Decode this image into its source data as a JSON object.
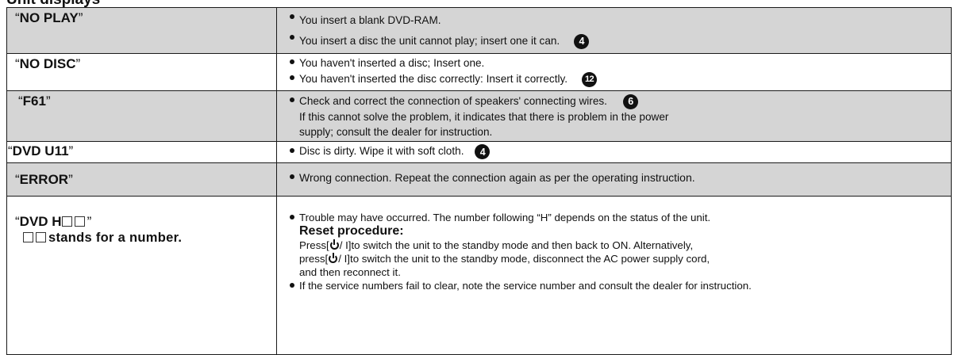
{
  "heading": "Unit displays",
  "rows": [
    {
      "code_open": "“",
      "code": "NO PLAY",
      "code_close": "”",
      "lines": [
        {
          "text": "You insert a blank DVD-RAM."
        },
        {
          "text": "You insert a disc the unit cannot play; insert one it can.",
          "ref": "4"
        }
      ]
    },
    {
      "code_open": "“",
      "code": "NO DISC",
      "code_close": "”",
      "lines": [
        {
          "text": "You haven't inserted a disc; Insert one."
        },
        {
          "text": "You haven't inserted the disc correctly: Insert it correctly.",
          "ref": "12"
        }
      ]
    },
    {
      "code_open": "“",
      "code": "F61",
      "code_close": "”",
      "lines": [
        {
          "text": "Check and correct the connection of speakers' connecting wires.",
          "ref": "6"
        },
        {
          "text": "If this cannot solve the problem, it indicates that there is problem in the power"
        },
        {
          "text": "supply; consult the dealer for instruction."
        }
      ]
    },
    {
      "code_open": "“",
      "code": "DVD U11",
      "code_close": "”",
      "lines": [
        {
          "text": "Disc is dirty. Wipe it with soft cloth.",
          "ref": "4"
        }
      ]
    },
    {
      "code_open": "“",
      "code": "ERROR",
      "code_close": "”",
      "lines": [
        {
          "text": "Wrong connection. Repeat the connection again as per the operating instruction."
        }
      ]
    },
    {
      "code_open": "“",
      "code": "DVD H",
      "code_close": "”",
      "sub": "stands for a number.",
      "trouble": "Trouble may have occurred. The number following “H” depends on the status of the unit.",
      "reset_title": "Reset procedure:",
      "reset_1a": "Press[",
      "reset_1b": "/ I]to switch the unit to the standby mode and then back to ON. Alternatively,",
      "reset_2a": "press[",
      "reset_2b": "/ I]to switch the unit to the standby mode, disconnect the AC power supply cord,",
      "reset_3": "and then reconnect it.",
      "fail": "If the service numbers fail to clear, note the service number and consult the dealer for instruction."
    }
  ]
}
